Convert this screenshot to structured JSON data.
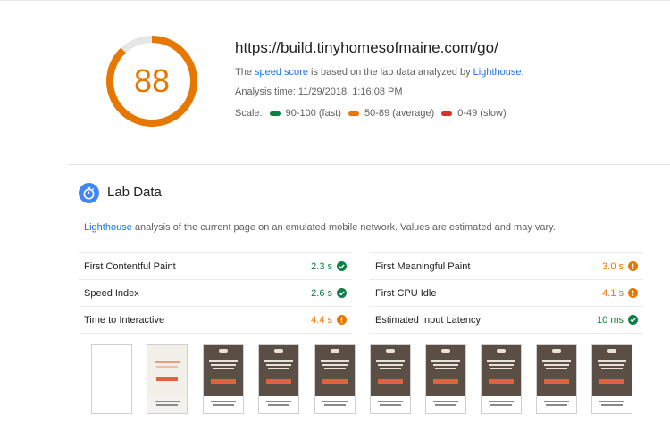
{
  "report": {
    "score": "88",
    "score_fraction": 0.88,
    "score_color": "#e67700",
    "url": "https://build.tinyhomesofmaine.com/go/",
    "desc_prefix": "The ",
    "desc_link1": "speed score",
    "desc_middle": " is based on the lab data analyzed by ",
    "desc_link2": "Lighthouse",
    "desc_suffix": ".",
    "analysis_time": "Analysis time: 11/29/2018, 1:16:08 PM",
    "scale_label": "Scale:",
    "scale": [
      {
        "label": "90-100 (fast)",
        "color": "#0b8043"
      },
      {
        "label": "50-89 (average)",
        "color": "#e67700"
      },
      {
        "label": "0-49 (slow)",
        "color": "#d93025"
      }
    ]
  },
  "lab": {
    "title": "Lab Data",
    "icon": "stopwatch-icon",
    "desc_link": "Lighthouse",
    "desc_text": " analysis of the current page on an emulated mobile network. Values are estimated and may vary.",
    "metrics_left": [
      {
        "name": "First Contentful Paint",
        "value": "2.3 s",
        "status": "pass"
      },
      {
        "name": "Speed Index",
        "value": "2.6 s",
        "status": "pass"
      },
      {
        "name": "Time to Interactive",
        "value": "4.4 s",
        "status": "average"
      }
    ],
    "metrics_right": [
      {
        "name": "First Meaningful Paint",
        "value": "3.0 s",
        "status": "average"
      },
      {
        "name": "First CPU Idle",
        "value": "4.1 s",
        "status": "average"
      },
      {
        "name": "Estimated Input Latency",
        "value": "10 ms",
        "status": "pass"
      }
    ]
  },
  "colors": {
    "pass": "#0b8043",
    "average": "#e67700",
    "fail": "#d93025",
    "link": "#1a73e8",
    "brand_blue": "#4285f4"
  }
}
